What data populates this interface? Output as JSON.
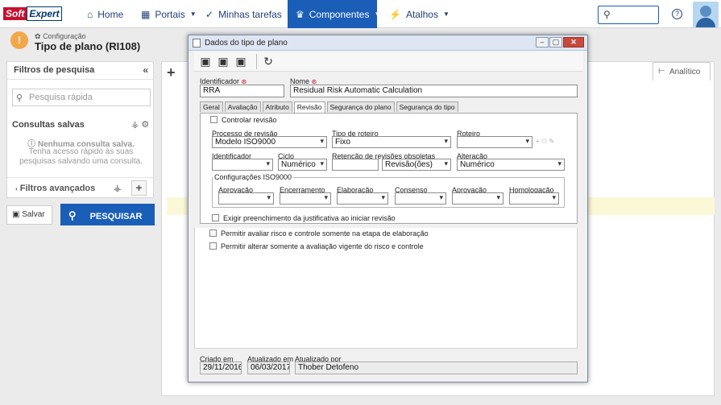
{
  "app": {
    "logo_part1": "Soft",
    "logo_part2": "Expert",
    "nav": [
      {
        "label": "Home",
        "icon": "home-icon"
      },
      {
        "label": "Portais",
        "icon": "grid-icon"
      },
      {
        "label": "Minhas tarefas",
        "icon": "check-icon"
      },
      {
        "label": "Componentes",
        "icon": "trophy-icon"
      },
      {
        "label": "Atalhos",
        "icon": "bolt-icon"
      }
    ],
    "help": "?"
  },
  "page": {
    "breadcrumb": "Configuração",
    "title": "Tipo de plano (RI108)"
  },
  "left_panel": {
    "header": "Filtros de pesquisa",
    "quick_search_placeholder": "Pesquisa rápida",
    "saved_queries": "Consultas salvas",
    "no_saved": "Nenhuma consulta salva.",
    "hint": "Tenha acesso rápido às suas pesquisas salvando uma consulta.",
    "advanced": "Filtros avançados",
    "save_button": "Salvar",
    "search_button": "PESQUISAR"
  },
  "right_area": {
    "tab": "Analítico"
  },
  "dialog": {
    "title": "Dados do tipo de plano",
    "identificador_label": "Identificador",
    "identificador_value": "RRA",
    "nome_label": "Nome",
    "nome_value": "Residual Risk Automatic Calculation",
    "tabs": [
      "Geral",
      "Avaliação",
      "Atributo",
      "Revisão",
      "Segurança do plano",
      "Segurança do tipo"
    ],
    "active_tab": "Revisão",
    "controlar_revisao": "Controlar revisão",
    "processo_label": "Processo de revisão",
    "processo_value": "Modelo ISO9000",
    "tipo_roteiro_label": "Tipo de roteiro",
    "tipo_roteiro_value": "Fixo",
    "roteiro_label": "Roteiro",
    "roteiro_value": "",
    "identificador2_label": "Identificador",
    "ciclo_label": "Ciclo",
    "ciclo_value": "Numérico",
    "retencao_label": "Retenção de revisões obsoletas",
    "retencao_value": "Revisão(ões)",
    "alteracao_label": "Alteração",
    "alteracao_value": "Numérico",
    "iso_legend": "Configurações ISO9000",
    "iso_fields": [
      "Aprovação",
      "Encerramento",
      "Elaboração",
      "Consenso",
      "Aprovação",
      "Homologação"
    ],
    "exigir": "Exigir preenchimento da justificativa ao iniciar revisão",
    "permitir1": "Permitir avaliar risco e controle somente na etapa de elaboração",
    "permitir2": "Permitir alterar somente a avaliação vigente do risco e controle",
    "criado_label": "Criado em",
    "criado_value": "29/11/2016",
    "atualizado_label": "Atualizado em",
    "atualizado_value": "06/03/2017",
    "atualizado_por_label": "Atualizado por",
    "atualizado_por_value": "Thober Detofeno"
  },
  "colors": {
    "primary": "#1a5eb8",
    "brand_red": "#c8102e",
    "warning": "#f3a64a"
  }
}
